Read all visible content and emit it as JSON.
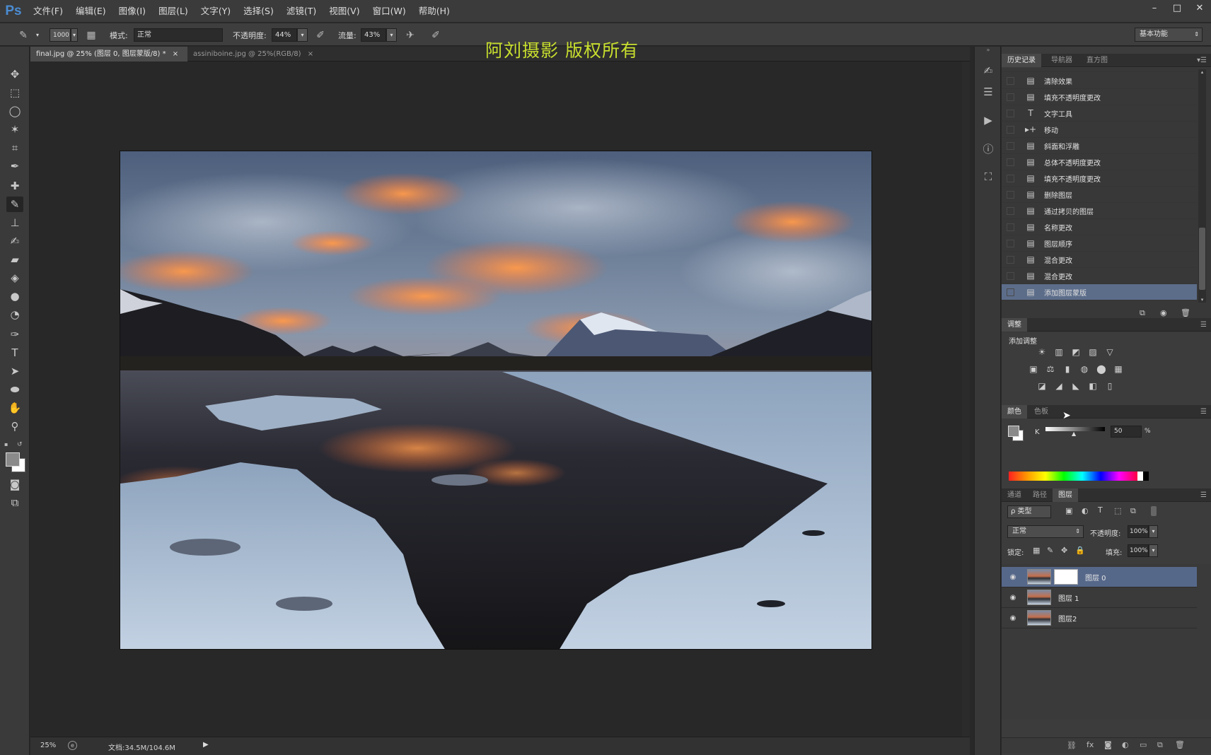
{
  "app": {
    "logo": "Ps"
  },
  "menubar": {
    "items": [
      "文件(F)",
      "编辑(E)",
      "图像(I)",
      "图层(L)",
      "文字(Y)",
      "选择(S)",
      "滤镜(T)",
      "视图(V)",
      "窗口(W)",
      "帮助(H)"
    ],
    "window_controls": [
      "–",
      "□",
      "✕"
    ]
  },
  "options": {
    "brush_size": "1000",
    "mode_label": "模式:",
    "mode_value": "正常",
    "opacity_label": "不透明度:",
    "opacity_value": "44%",
    "flow_label": "流量:",
    "flow_value": "43%",
    "workspace": "基本功能"
  },
  "watermark": "阿刘摄影  版权所有",
  "tabs": [
    {
      "label": "final.jpg @ 25% (图层 0, 图层蒙版/8) *",
      "close": "×"
    },
    {
      "label": "assiniboine.jpg @ 25%(RGB/8)",
      "close": "×"
    }
  ],
  "status": {
    "zoom": "25%",
    "doc": "文档:34.5M/104.6M"
  },
  "history": {
    "tabs": [
      "历史记录",
      "导航器",
      "直方图"
    ],
    "items": [
      {
        "icon": "▤",
        "label": "清除效果"
      },
      {
        "icon": "▤",
        "label": "填充不透明度更改"
      },
      {
        "icon": "T",
        "label": "文字工具"
      },
      {
        "icon": "▸+",
        "label": "移动"
      },
      {
        "icon": "▤",
        "label": "斜面和浮雕"
      },
      {
        "icon": "▤",
        "label": "总体不透明度更改"
      },
      {
        "icon": "▤",
        "label": "填充不透明度更改"
      },
      {
        "icon": "▤",
        "label": "删除图层"
      },
      {
        "icon": "▤",
        "label": "通过拷贝的图层"
      },
      {
        "icon": "▤",
        "label": "名称更改"
      },
      {
        "icon": "▤",
        "label": "图层顺序"
      },
      {
        "icon": "▤",
        "label": "混合更改"
      },
      {
        "icon": "▤",
        "label": "混合更改"
      },
      {
        "icon": "▤",
        "label": "添加图层蒙版"
      }
    ]
  },
  "adjustments": {
    "tab": "调整",
    "title": "添加调整",
    "row1": [
      "☀",
      "▥",
      "◩",
      "▨",
      "▽"
    ],
    "row2": [
      "▣",
      "⚖",
      "▮",
      "◍",
      "⬤",
      "▦"
    ],
    "row3": [
      "◪",
      "◢",
      "◣",
      "◧",
      "▯"
    ]
  },
  "color": {
    "tabs": [
      "颜色",
      "色板"
    ],
    "channel": "K",
    "value": "50",
    "unit": "%"
  },
  "layers": {
    "tabs": [
      "通道",
      "路径",
      "图层"
    ],
    "filter_label": "ρ 类型",
    "blend_mode": "正常",
    "opacity_label": "不透明度:",
    "opacity_value": "100%",
    "lock_label": "锁定:",
    "fill_label": "填充:",
    "fill_value": "100%",
    "items": [
      {
        "name": "图层 0",
        "mask": true,
        "selected": true
      },
      {
        "name": "图层 1",
        "mask": false,
        "selected": false
      },
      {
        "name": "图层2",
        "mask": false,
        "selected": false
      }
    ]
  }
}
